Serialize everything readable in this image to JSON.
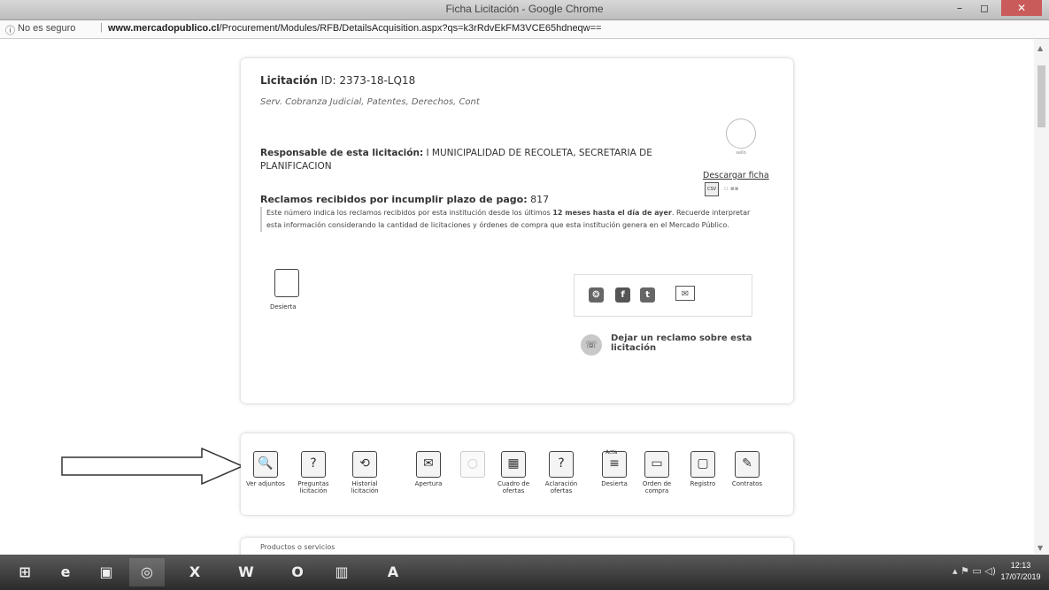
{
  "window": {
    "title": "Ficha Licitación - Google Chrome",
    "minimize": "–",
    "maximize": "◻",
    "close": "✕"
  },
  "address": {
    "security_icon": "ⓘ",
    "security_text": "No es seguro",
    "separator": "|",
    "host": "www.mercadopublico.cl",
    "path": "/Procurement/Modules/RFB/DetailsAcquisition.aspx?qs=k3rRdvEkFM3VCE65hdneqw=="
  },
  "licitacion": {
    "label": "Licitación",
    "id_prefix": "ID:",
    "id": "2373-18-LQ18",
    "name": "Serv. Cobranza Judicial, Patentes, Derechos, Cont",
    "responsable_label": "Responsable de esta licitación:",
    "responsable_value": "I MUNICIPALIDAD DE RECOLETA, SECRETARIA DE PLANIFICACION",
    "seal_text": "sello",
    "download_label": "Descargar ficha",
    "csv_label": "CSV",
    "reclamos_label": "Reclamos recibidos por incumplir plazo de pago:",
    "reclamos_value": "817",
    "reclamos_note_1": "Este número indica los reclamos recibidos por esta institución desde los últimos",
    "reclamos_note_bold": "12 meses hasta el día de ayer",
    "reclamos_note_2": ". Recuerde interpretar esta información considerando la cantidad de licitaciones y órdenes de compra que esta institución genera en el Mercado Público.",
    "desierta_label": "Desierta",
    "social": {
      "rss": "❂",
      "facebook": "f",
      "twitter": "t",
      "mail": "✉"
    },
    "reclamo_link": "Dejar un reclamo sobre esta licitación"
  },
  "toolbar": {
    "items": [
      {
        "icon": "magnifier-doc",
        "glyph": "🔍",
        "label": "Ver adjuntos"
      },
      {
        "icon": "question",
        "glyph": "?",
        "label": "Preguntas licitación"
      },
      {
        "icon": "history",
        "glyph": "⟲",
        "label": "Historial licitación"
      },
      {
        "icon": "envelope",
        "glyph": "✉",
        "label": "Apertura"
      },
      {
        "icon": "disabled",
        "glyph": "○",
        "label": ""
      },
      {
        "icon": "table",
        "glyph": "▦",
        "label": "Cuadro de ofertas"
      },
      {
        "icon": "aclaracion",
        "glyph": "?",
        "label": "Aclaración ofertas"
      },
      {
        "icon": "acta",
        "glyph": "≡",
        "label": "Desierta"
      },
      {
        "icon": "orden",
        "glyph": "▭",
        "label": "Orden de compra"
      },
      {
        "icon": "registro",
        "glyph": "▢",
        "label": "Registro"
      },
      {
        "icon": "contratos",
        "glyph": "✎",
        "label": "Contratos"
      }
    ],
    "acta_tag": "Acta"
  },
  "card3": {
    "title": "Productos o servicios"
  },
  "taskbar": {
    "items": [
      "⊞",
      "e",
      "▣",
      "◎",
      "X",
      "W",
      "O",
      "▥",
      "A"
    ],
    "tray": "▴  ⚑  ▭  ◁)",
    "time": "12:13",
    "date": "17/07/2019"
  }
}
